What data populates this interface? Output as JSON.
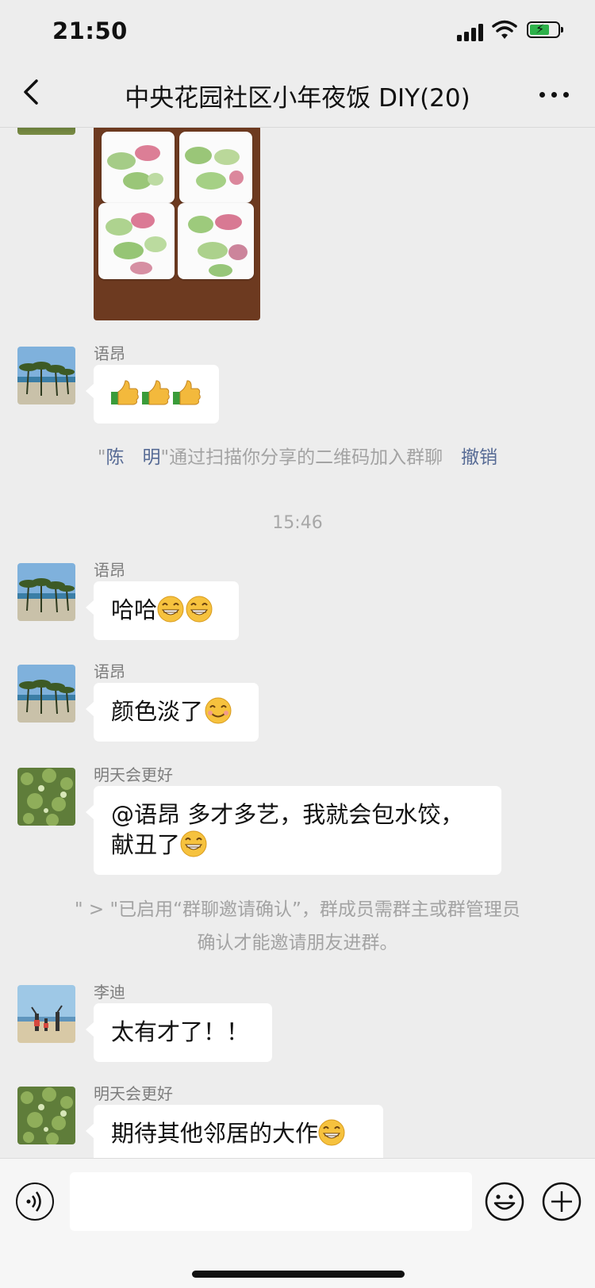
{
  "status_bar": {
    "time": "21:50"
  },
  "header": {
    "title": "中央花园社区小年夜饭 DIY(20)"
  },
  "messages": {
    "m1": {
      "sender": "语昂",
      "avatar": "beach-palm-avatar",
      "content": "thumbs-up-emoji x3"
    },
    "sys1": {
      "quote_open": "\"",
      "name": "陈　明",
      "text": "\"通过扫描你分享的二维码加入群聊",
      "action": "撤销"
    },
    "stamp": "15:46",
    "m2": {
      "sender": "语昂",
      "text": "哈哈"
    },
    "m3": {
      "sender": "语昂",
      "text": "颜色淡了"
    },
    "m4": {
      "sender": "明天会更好",
      "line1": "@语昂 多才多艺，我就会包水饺，",
      "line2": "献丑了"
    },
    "sys2": {
      "line1": "\" > \"已启用“群聊邀请确认”，群成员需群主或群管理员",
      "line2": "确认才能邀请朋友进群。"
    },
    "m5": {
      "sender": "李迪",
      "text": "太有才了！！"
    },
    "m6": {
      "sender": "明天会更好",
      "text": "期待其他邻居的大作"
    }
  },
  "colors": {
    "bg": "#ededed",
    "link": "#576b95",
    "bubble": "#ffffff"
  },
  "icons": [
    "chevron-left-icon",
    "more-dots-icon",
    "voice-icon",
    "emoji-icon",
    "plus-icon",
    "grin-emoji",
    "smile-emoji",
    "thumbs-up-emoji"
  ]
}
